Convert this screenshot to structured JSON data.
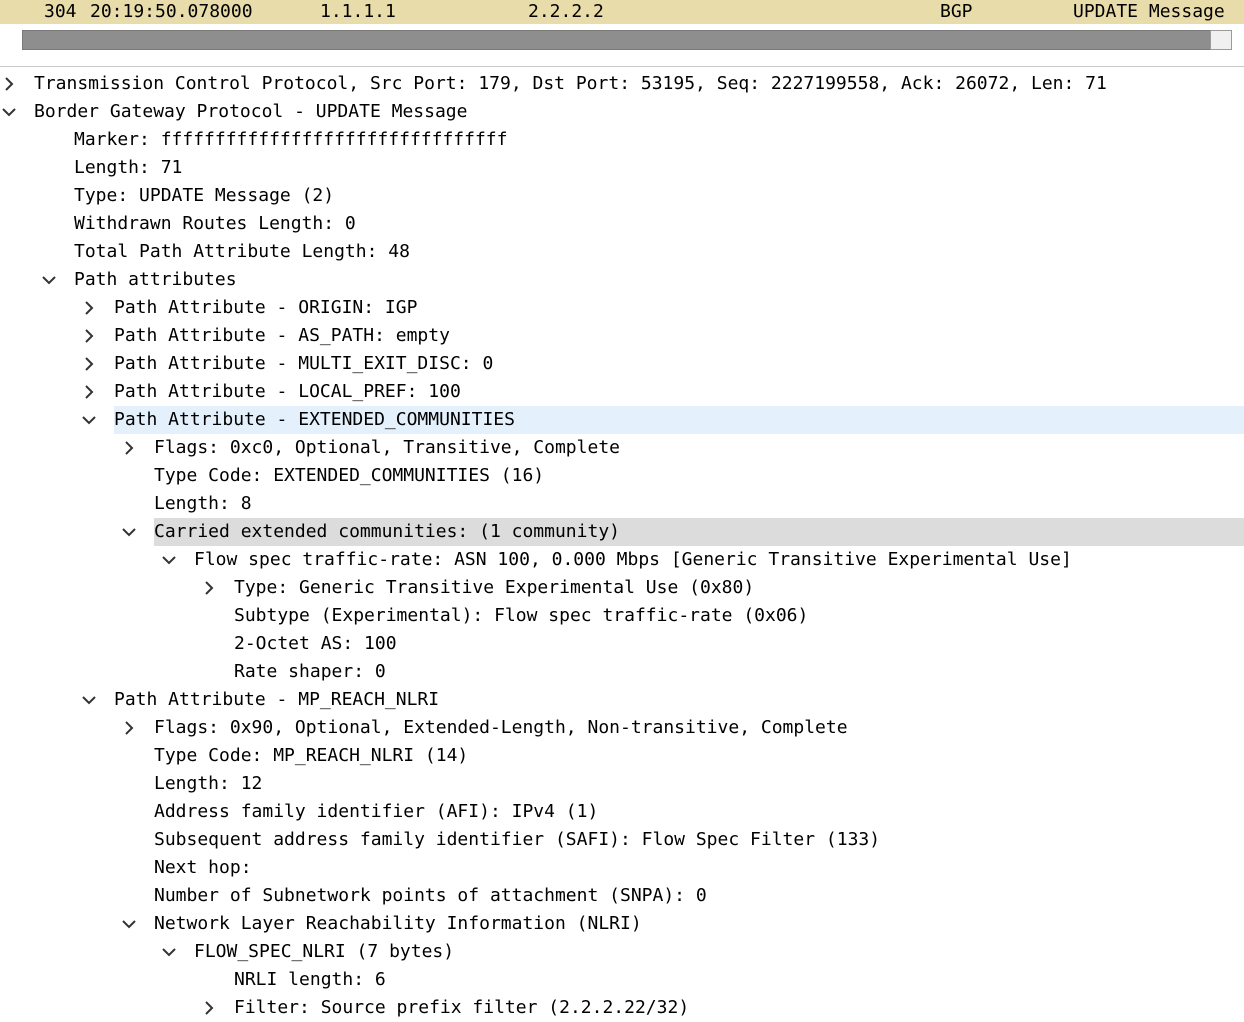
{
  "packet": {
    "no": "304",
    "time": "20:19:50.078000",
    "source": "1.1.1.1",
    "destination": "2.2.2.2",
    "protocol": "BGP",
    "info": "UPDATE Message"
  },
  "colors": {
    "packet_row": "#e7dcaa",
    "selected_row": "#e4f0fb",
    "hover_row": "#dcdcdc"
  },
  "tree": [
    {
      "text": "Transmission Control Protocol, Src Port: 179, Dst Port: 53195, Seq: 2227199558, Ack: 26072, Len: 71",
      "level": 0,
      "toggle": "collapsed",
      "name": "tcp-tree-item"
    },
    {
      "text": "Border Gateway Protocol - UPDATE Message",
      "level": 0,
      "toggle": "expanded",
      "name": "bgp-tree-item"
    },
    {
      "text": "Marker: ffffffffffffffffffffffffffffffff",
      "level": 1,
      "toggle": "none",
      "name": "bgp-marker"
    },
    {
      "text": "Length: 71",
      "level": 1,
      "toggle": "none",
      "name": "bgp-length"
    },
    {
      "text": "Type: UPDATE Message (2)",
      "level": 1,
      "toggle": "none",
      "name": "bgp-type"
    },
    {
      "text": "Withdrawn Routes Length: 0",
      "level": 1,
      "toggle": "none",
      "name": "withdrawn-routes-length"
    },
    {
      "text": "Total Path Attribute Length: 48",
      "level": 1,
      "toggle": "none",
      "name": "total-path-attr-length"
    },
    {
      "text": "Path attributes",
      "level": 1,
      "toggle": "expanded",
      "name": "path-attributes"
    },
    {
      "text": "Path Attribute - ORIGIN: IGP",
      "level": 2,
      "toggle": "collapsed",
      "name": "attr-origin"
    },
    {
      "text": "Path Attribute - AS_PATH: empty",
      "level": 2,
      "toggle": "collapsed",
      "name": "attr-as-path"
    },
    {
      "text": "Path Attribute - MULTI_EXIT_DISC: 0",
      "level": 2,
      "toggle": "collapsed",
      "name": "attr-med"
    },
    {
      "text": "Path Attribute - LOCAL_PREF: 100",
      "level": 2,
      "toggle": "collapsed",
      "name": "attr-local-pref"
    },
    {
      "text": "Path Attribute - EXTENDED_COMMUNITIES",
      "level": 2,
      "toggle": "expanded",
      "name": "attr-extended-communities",
      "highlight": "blue"
    },
    {
      "text": "Flags: 0xc0, Optional, Transitive, Complete",
      "level": 3,
      "toggle": "collapsed",
      "name": "ext-comm-flags"
    },
    {
      "text": "Type Code: EXTENDED_COMMUNITIES (16)",
      "level": 3,
      "toggle": "none",
      "name": "ext-comm-type-code"
    },
    {
      "text": "Length: 8",
      "level": 3,
      "toggle": "none",
      "name": "ext-comm-length"
    },
    {
      "text": "Carried extended communities: (1 community)",
      "level": 3,
      "toggle": "expanded",
      "name": "carried-ext-communities",
      "highlight": "gray"
    },
    {
      "text": "Flow spec traffic-rate: ASN 100, 0.000 Mbps [Generic Transitive Experimental Use]",
      "level": 4,
      "toggle": "expanded",
      "name": "flowspec-traffic-rate"
    },
    {
      "text": "Type: Generic Transitive Experimental Use (0x80)",
      "level": 5,
      "toggle": "collapsed",
      "name": "community-type"
    },
    {
      "text": "Subtype (Experimental): Flow spec traffic-rate (0x06)",
      "level": 5,
      "toggle": "none",
      "name": "community-subtype"
    },
    {
      "text": "2-Octet AS: 100",
      "level": 5,
      "toggle": "none",
      "name": "community-as"
    },
    {
      "text": "Rate shaper: 0",
      "level": 5,
      "toggle": "none",
      "name": "rate-shaper"
    },
    {
      "text": "Path Attribute - MP_REACH_NLRI",
      "level": 2,
      "toggle": "expanded",
      "name": "attr-mp-reach-nlri"
    },
    {
      "text": "Flags: 0x90, Optional, Extended-Length, Non-transitive, Complete",
      "level": 3,
      "toggle": "collapsed",
      "name": "mp-reach-flags"
    },
    {
      "text": "Type Code: MP_REACH_NLRI (14)",
      "level": 3,
      "toggle": "none",
      "name": "mp-reach-type-code"
    },
    {
      "text": "Length: 12",
      "level": 3,
      "toggle": "none",
      "name": "mp-reach-length"
    },
    {
      "text": "Address family identifier (AFI): IPv4 (1)",
      "level": 3,
      "toggle": "none",
      "name": "afi"
    },
    {
      "text": "Subsequent address family identifier (SAFI): Flow Spec Filter (133)",
      "level": 3,
      "toggle": "none",
      "name": "safi"
    },
    {
      "text": "Next hop:",
      "level": 3,
      "toggle": "none",
      "name": "next-hop"
    },
    {
      "text": "Number of Subnetwork points of attachment (SNPA): 0",
      "level": 3,
      "toggle": "none",
      "name": "snpa-count"
    },
    {
      "text": "Network Layer Reachability Information (NLRI)",
      "level": 3,
      "toggle": "expanded",
      "name": "nlri"
    },
    {
      "text": "FLOW_SPEC_NLRI (7 bytes)",
      "level": 4,
      "toggle": "expanded",
      "name": "flow-spec-nlri"
    },
    {
      "text": "NRLI length: 6",
      "level": 5,
      "toggle": "none",
      "name": "nlri-length"
    },
    {
      "text": "Filter: Source prefix filter (2.2.2.22/32)",
      "level": 5,
      "toggle": "collapsed",
      "name": "source-prefix-filter"
    }
  ]
}
